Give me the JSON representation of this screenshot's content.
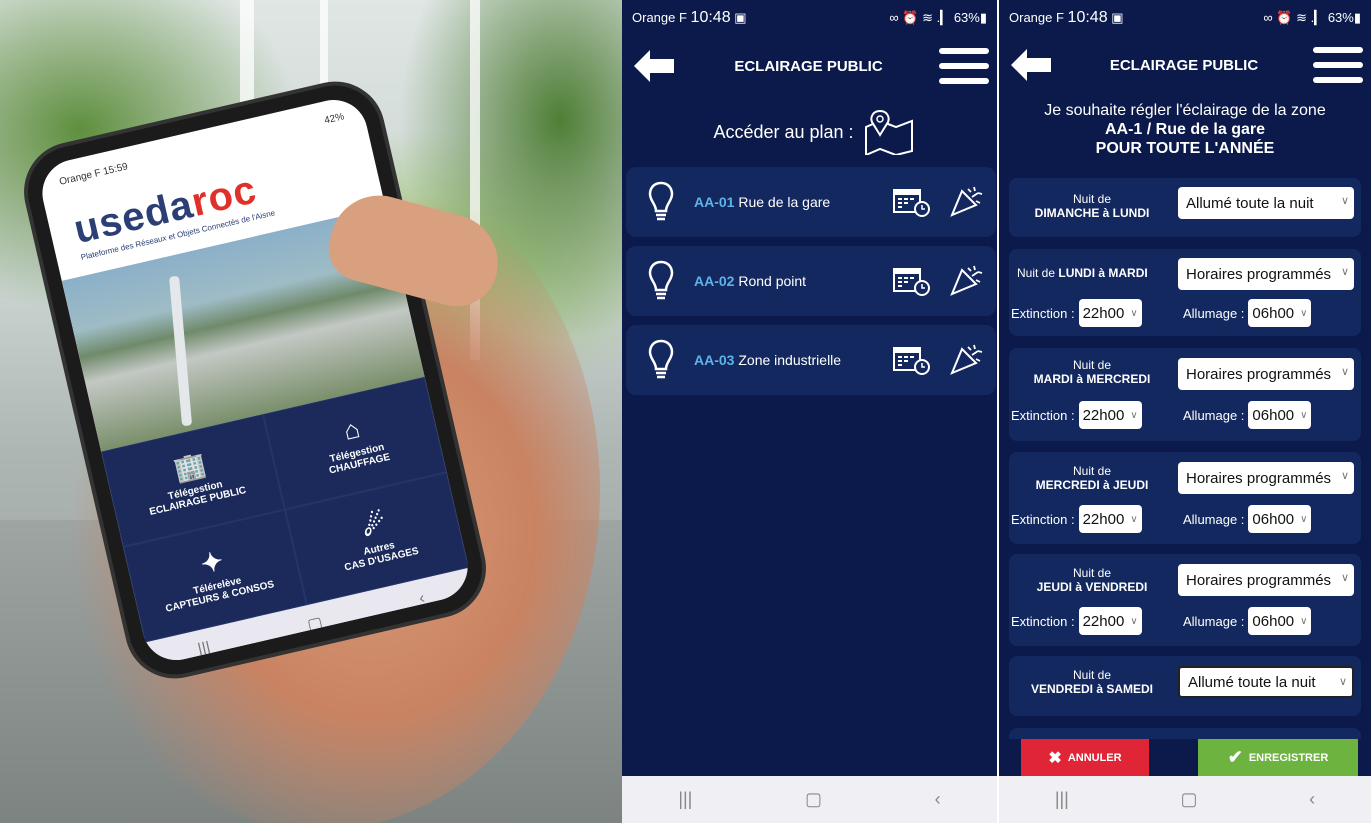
{
  "photo": {
    "status_left": "Orange F 15:59",
    "status_right": "42%",
    "logo_main": "useda",
    "logo_accent": "roc",
    "tagline": "Plateforme des Réseaux et Objets Connectés de l'Aisne",
    "tiles": [
      {
        "icon": "streetlight-building-icon",
        "line1": "Télégestion",
        "line2": "ECLAIRAGE PUBLIC"
      },
      {
        "icon": "house-thermometer-icon",
        "line1": "Télégestion",
        "line2": "CHAUFFAGE"
      },
      {
        "icon": "sensor-network-icon",
        "line1": "Télérelève",
        "line2": "CAPTEURS & CONSOS"
      },
      {
        "icon": "satellite-icon",
        "line1": "Autres",
        "line2": "CAS D'USAGES"
      }
    ]
  },
  "screen2": {
    "status": {
      "carrier": "Orange F",
      "time": "10:48",
      "battery": "63%"
    },
    "title": "ECLAIRAGE PUBLIC",
    "plan_label": "Accéder au plan :",
    "zones": [
      {
        "code": "AA-01",
        "name": "Rue de la gare"
      },
      {
        "code": "AA-02",
        "name": "Rond point"
      },
      {
        "code": "AA-03",
        "name": "Zone industrielle"
      }
    ]
  },
  "screen3": {
    "status": {
      "carrier": "Orange F",
      "time": "10:48",
      "battery": "63%"
    },
    "title": "ECLAIRAGE PUBLIC",
    "intro_line1": "Je souhaite régler l'éclairage de la zone",
    "intro_zone": "AA-1 / Rue de la gare",
    "intro_period": "POUR TOUTE L'ANNÉE",
    "extinction_label": "Extinction :",
    "allumage_label": "Allumage :",
    "nights": [
      {
        "prefix": "Nuit de",
        "days": "DIMANCHE à LUNDI",
        "mode": "Allumé toute la nuit"
      },
      {
        "prefix": "Nuit de",
        "days": "LUNDI à MARDI",
        "mode": "Horaires programmés",
        "extinction": "22h00",
        "allumage": "06h00"
      },
      {
        "prefix": "Nuit de",
        "days": "MARDI à MERCREDI",
        "mode": "Horaires programmés",
        "extinction": "22h00",
        "allumage": "06h00"
      },
      {
        "prefix": "Nuit de",
        "days": "MERCREDI à JEUDI",
        "mode": "Horaires programmés",
        "extinction": "22h00",
        "allumage": "06h00"
      },
      {
        "prefix": "Nuit de",
        "days": "JEUDI à VENDREDI",
        "mode": "Horaires programmés",
        "extinction": "22h00",
        "allumage": "06h00"
      },
      {
        "prefix": "Nuit de",
        "days": "VENDREDI à SAMEDI",
        "mode": "Allumé toute la nuit"
      }
    ],
    "cancel_label": "ANNULER",
    "save_label": "ENREGISTRER",
    "colors": {
      "background": "#0b1a4a",
      "card": "#13285f",
      "cancel": "#e02537",
      "save": "#6cb33f",
      "zone_code": "#5fb3ea"
    }
  }
}
